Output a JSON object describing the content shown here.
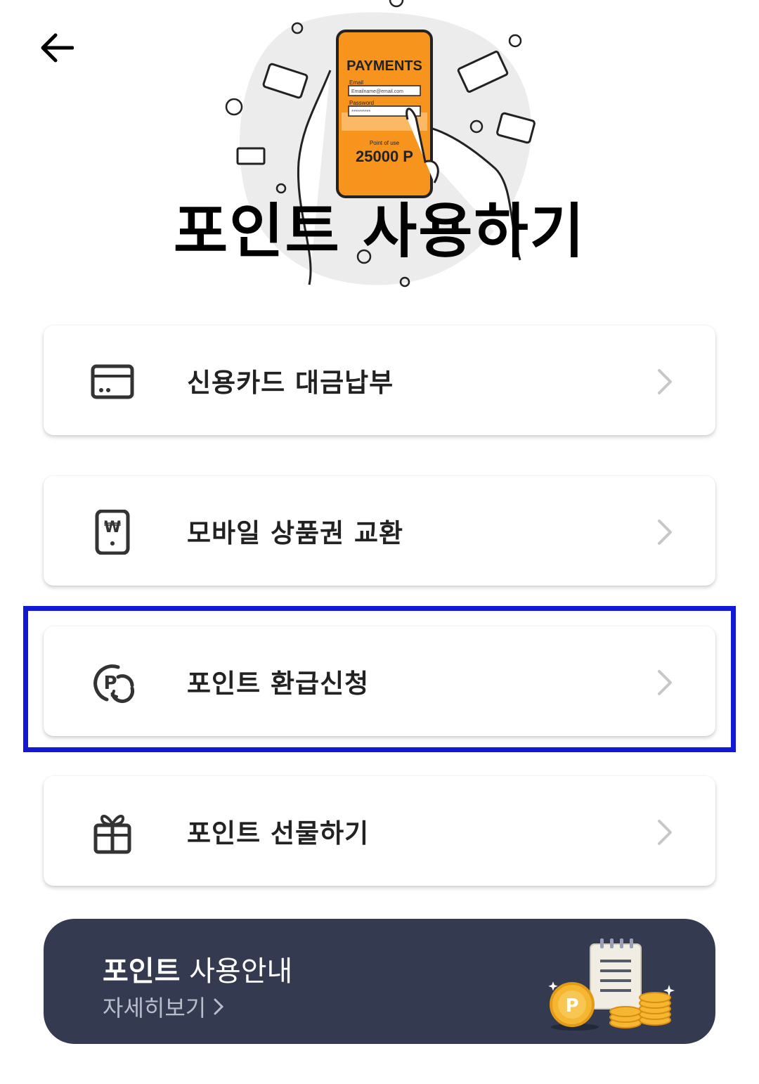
{
  "header": {
    "back_icon": "arrow-left-icon",
    "title": "포인트 사용하기"
  },
  "hero": {
    "phone_heading": "PAYMENTS",
    "email_label": "Email",
    "email_value": "Emailname@email.com",
    "password_label": "Password",
    "password_value": "**********",
    "point_label": "Point of use",
    "point_value": "25000 P",
    "colors": {
      "phone": "#f7941d",
      "blob": "#ececec"
    }
  },
  "menu": [
    {
      "label": "신용카드 대금납부",
      "icon": "credit-card-icon"
    },
    {
      "label": "모바일 상품권 교환",
      "icon": "mobile-voucher-icon"
    },
    {
      "label": "포인트 환급신청",
      "icon": "point-refund-icon",
      "highlighted": true
    },
    {
      "label": "포인트 선물하기",
      "icon": "gift-icon"
    }
  ],
  "banner": {
    "title_bold": "포인트",
    "title_rest": " 사용안내",
    "link": "자세히보기",
    "coin_letter": "P",
    "colors": {
      "background": "#343a4f",
      "coin": "#f5b631"
    }
  },
  "colors": {
    "highlight": "#1219d6"
  }
}
